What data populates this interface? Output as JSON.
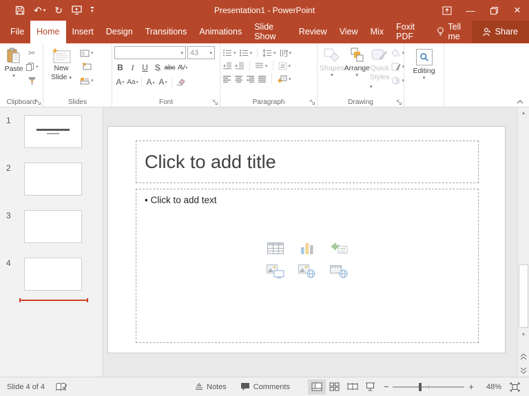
{
  "titlebar": {
    "title": "Presentation1 - PowerPoint"
  },
  "tabs": {
    "items": [
      "File",
      "Home",
      "Insert",
      "Design",
      "Transitions",
      "Animations",
      "Slide Show",
      "Review",
      "View",
      "Mix",
      "Foxit PDF"
    ],
    "tell_me": "Tell me",
    "share": "Share"
  },
  "ribbon": {
    "clipboard": {
      "label": "Clipboard",
      "paste": "Paste"
    },
    "slides": {
      "label": "Slides",
      "new_line1": "New",
      "new_line2": "Slide"
    },
    "font": {
      "label": "Font",
      "font_name": "",
      "font_size": "43",
      "bold": "B",
      "italic": "I",
      "underline": "U",
      "text_shadow": "S",
      "strikethrough": "abc",
      "char_spacing": "AV",
      "font_color": "A",
      "change_case": "Aa",
      "grow_font": "A",
      "shrink_font": "A"
    },
    "paragraph": {
      "label": "Paragraph"
    },
    "drawing": {
      "label": "Drawing",
      "shapes": "Shapes",
      "arrange": "Arrange",
      "quick_line1": "Quick",
      "quick_line2": "Styles"
    },
    "editing": {
      "label": "Editing"
    }
  },
  "slide_panel": {
    "numbers": [
      "1",
      "2",
      "3",
      "4"
    ]
  },
  "slide": {
    "title_placeholder": "Click to add title",
    "bullet": "•",
    "body_placeholder": "Click to add text"
  },
  "statusbar": {
    "slide_counter": "Slide 4 of 4",
    "notes": "Notes",
    "comments": "Comments",
    "zoom_out": "−",
    "zoom_in": "+",
    "zoom_level": "48%"
  },
  "glyphs": {
    "caret": "▾",
    "undo": "↶",
    "redo": "↻",
    "scissors": "✂",
    "minimize": "—",
    "close": "×",
    "scroll_up": "▴",
    "scroll_down": "▾",
    "grow_caret": "▴",
    "shrink_caret": "▾"
  },
  "colors": {
    "accent": "#B7472A",
    "share_bg": "#A33E1F",
    "red_line": "#CC4125"
  }
}
